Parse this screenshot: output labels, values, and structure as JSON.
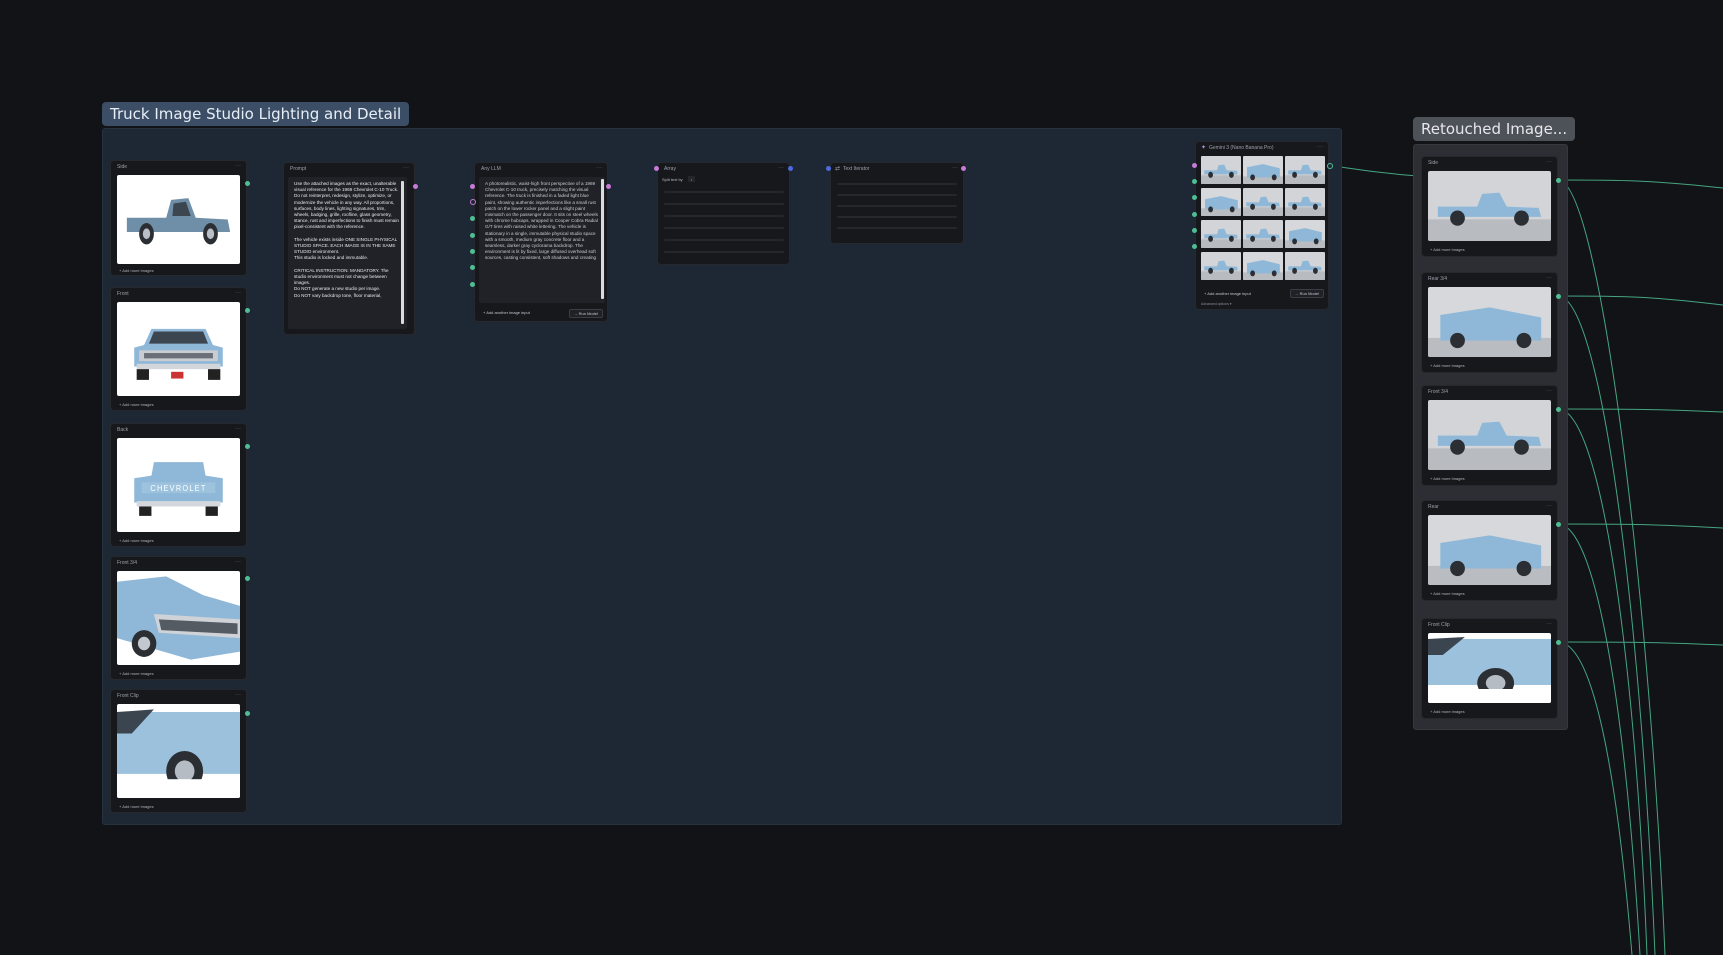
{
  "groups": {
    "studio": {
      "title": "Truck Image Studio Lighting and Detail"
    },
    "retouched": {
      "title": "Retouched Image..."
    }
  },
  "input_nodes": [
    {
      "title": "Side",
      "add_label": "+ Add more images"
    },
    {
      "title": "Front",
      "add_label": "+ Add more images"
    },
    {
      "title": "Back",
      "add_label": "+ Add more images"
    },
    {
      "title": "Front 3/4",
      "add_label": "+ Add more images"
    },
    {
      "title": "Front Clip",
      "add_label": "+ Add more images"
    }
  ],
  "prompt_node": {
    "title": "Prompt",
    "text": "Use the attached images as the exact, unalterable visual reference for the 1969 Chevrolet C-10 Truck. Do not reinterpret, redesign, stylize, optimize, or modernize the vehicle in any way. All proportions, surfaces, body lines, lighting signatures, trim, wheels, badging, grille, roofline, glass geometry, stance, rust and imperfections to finish must remain pixel-consistent with the reference.\n\nThe vehicle exists inside ONE SINGLE PHYSICAL STUDIO SPACE. EACH IMAGE IS IN THE SAME STUDIO environment.\nThis studio is locked and immutable.\n\nCRITICAL INSTRUCTION: MANDATORY. The studio environment must not change between images.\nDo NOT generate a new studio per image.\nDo NOT vary backdrop tone, floor material,"
  },
  "llm_node": {
    "title": "Any LLM",
    "text": "A photorealistic, waist-high front perspective of a 1969 Chevrolet C-10 truck, precisely matching the visual reference. The truck is finished in a faded light blue paint, showing authentic imperfections like a small rust patch on the lower rocker panel and a slight paint mismatch on the passenger door. It sits on steel wheels with chrome hubcaps, wrapped in Cooper Cobra Radial G/T tires with raised white lettering. The vehicle is stationary in a single, immutable physical studio space with a smooth, medium gray concrete floor and a seamless, darker gray cyclorama backdrop. The environment is lit by fixed, large diffused overhead soft sources, casting consistent, soft shadows and creating",
    "add_input_label": "+ Add another image input",
    "run_label": "→ Run Model"
  },
  "array_node": {
    "title": "Array",
    "split_label": "Split text by",
    "split_value": ","
  },
  "iterator_node": {
    "title": "Text Iterator"
  },
  "gemini_node": {
    "title": "Gemini 3 (Nano Banana Pro)",
    "add_input_label": "+ Add another image input",
    "run_label": "→ Run Model",
    "advanced_label": "Advanced options ▾"
  },
  "output_nodes": [
    {
      "title": "Side",
      "add_label": "+ Add more images"
    },
    {
      "title": "Rear 3/4",
      "add_label": "+ Add more images"
    },
    {
      "title": "Front 3/4",
      "add_label": "+ Add more images"
    },
    {
      "title": "Rear",
      "add_label": "+ Add more images"
    },
    {
      "title": "Front Clip",
      "add_label": "+ Add more images"
    }
  ],
  "colors": {
    "canvas": "#121317",
    "group_fill": "#1e2834",
    "wire_green": "#4fbf93",
    "wire_pink": "#c77ad6",
    "wire_blue": "#4d6be0",
    "truck_blue": "#8fb8d8"
  }
}
